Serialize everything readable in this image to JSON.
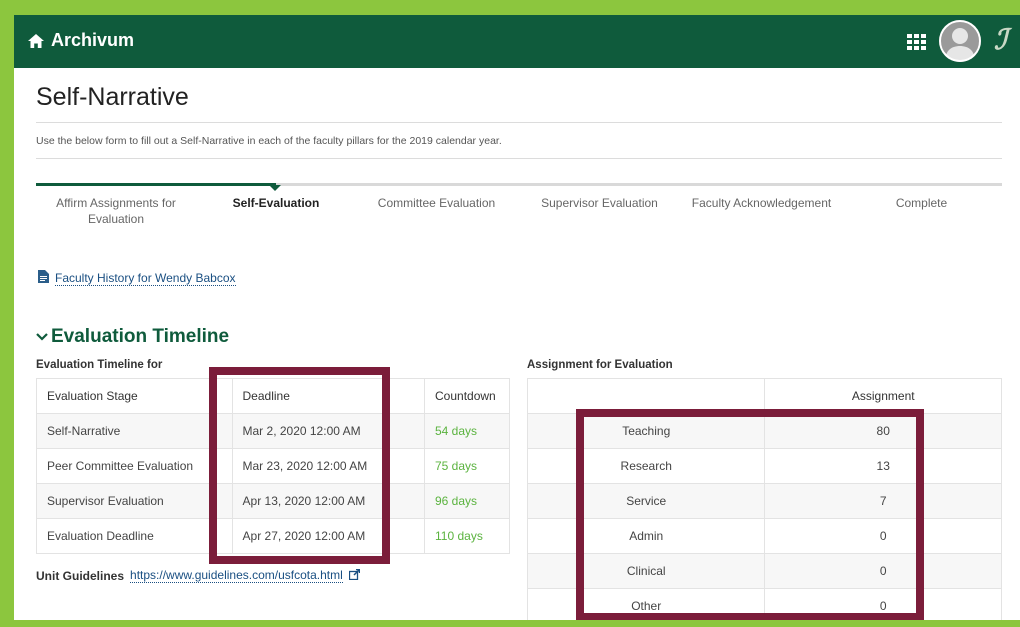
{
  "app": {
    "title": "Archivum"
  },
  "header": {
    "apps_icon": "apps-grid-icon",
    "avatar_icon": "user-avatar-icon",
    "logo_mark": "ℐ",
    "color": "#0f5b3c"
  },
  "page": {
    "title": "Self-Narrative",
    "intro": "Use the below form to fill out a Self-Narrative in each of the faculty pillars for the 2019 calendar year."
  },
  "stepper": {
    "steps": [
      {
        "label": "Affirm Assignments for Evaluation",
        "state": "done"
      },
      {
        "label": "Self-Evaluation",
        "state": "active"
      },
      {
        "label": "Committee Evaluation",
        "state": "pending"
      },
      {
        "label": "Supervisor Evaluation",
        "state": "pending"
      },
      {
        "label": "Faculty Acknowledgement",
        "state": "pending"
      },
      {
        "label": "Complete",
        "state": "pending"
      }
    ]
  },
  "history_link": "Faculty History for Wendy Babcox",
  "timeline": {
    "section_title": "Evaluation Timeline",
    "caption": "Evaluation Timeline for",
    "headers": [
      "Evaluation Stage",
      "Deadline",
      "Countdown"
    ],
    "rows": [
      {
        "stage": "Self-Narrative",
        "deadline": "Mar 2, 2020 12:00 AM",
        "countdown": "54 days"
      },
      {
        "stage": "Peer Committee Evaluation",
        "deadline": "Mar 23, 2020 12:00 AM",
        "countdown": "75 days"
      },
      {
        "stage": "Supervisor Evaluation",
        "deadline": "Apr 13, 2020 12:00 AM",
        "countdown": "96 days"
      },
      {
        "stage": "Evaluation Deadline",
        "deadline": "Apr 27, 2020 12:00 AM",
        "countdown": "110 days"
      }
    ]
  },
  "guidelines": {
    "label": "Unit Guidelines",
    "url": "https://www.guidelines.com/usfcota.html"
  },
  "assignment": {
    "caption": "Assignment for Evaluation",
    "headers": [
      "",
      "Assignment"
    ],
    "rows": [
      {
        "name": "Teaching",
        "value": "80"
      },
      {
        "name": "Research",
        "value": "13"
      },
      {
        "name": "Service",
        "value": "7"
      },
      {
        "name": "Admin",
        "value": "0"
      },
      {
        "name": "Clinical",
        "value": "0"
      },
      {
        "name": "Other",
        "value": "0"
      }
    ]
  },
  "colors": {
    "accent": "#0f5b3c",
    "highlight": "#7b1d3a",
    "countdown": "#5bb33f",
    "frame": "#8cc63e"
  }
}
